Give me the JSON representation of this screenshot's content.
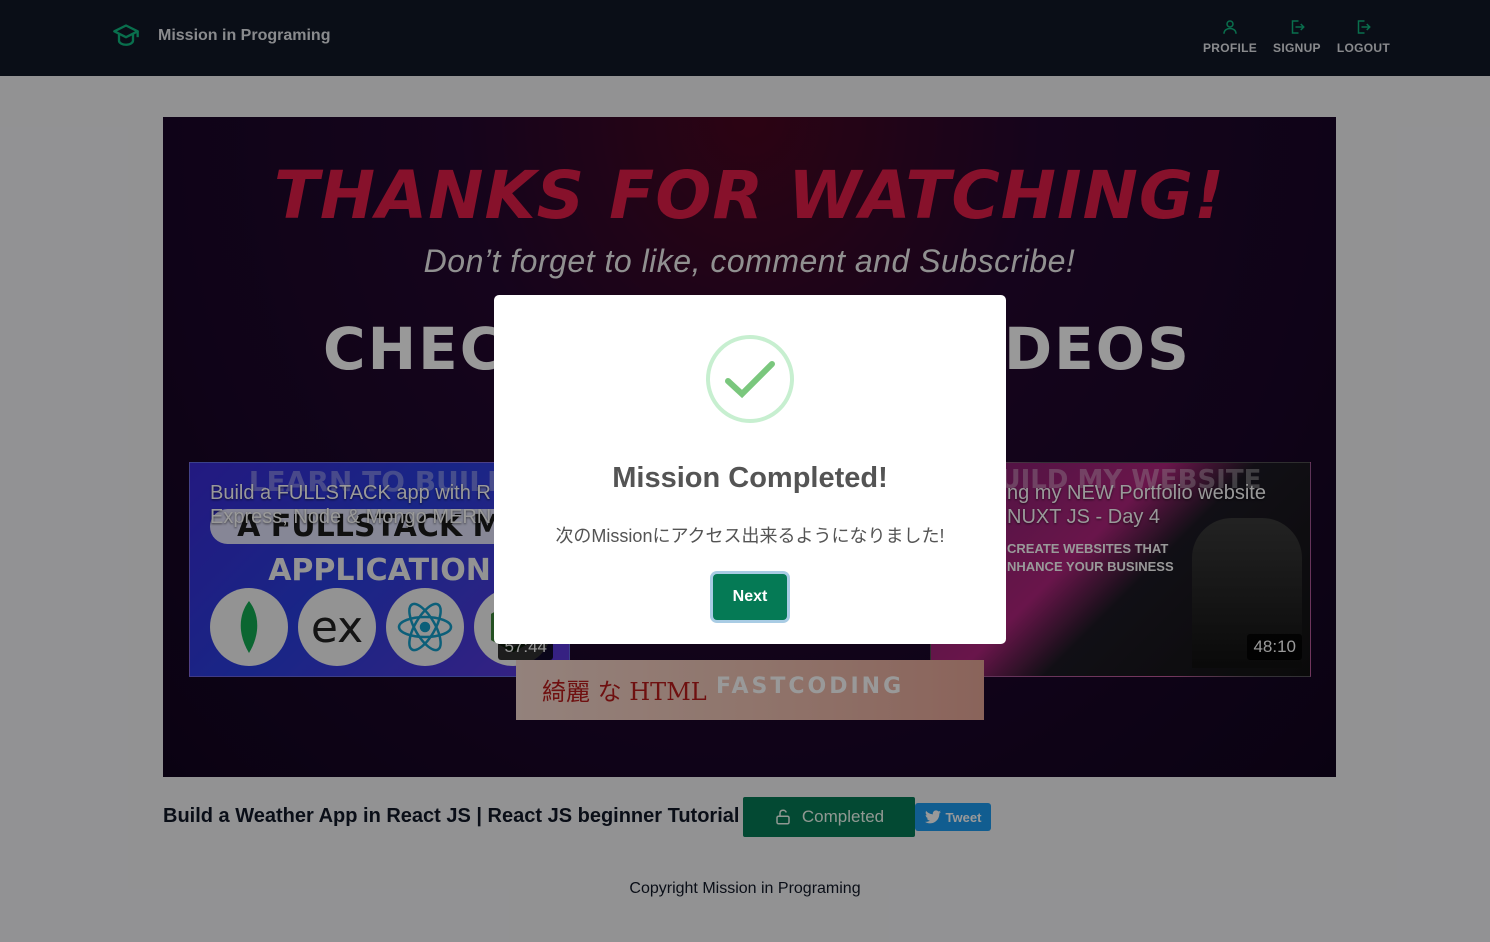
{
  "header": {
    "brand_title": "Mission in Programing",
    "brand_icon": "graduation-cap-icon",
    "nav": [
      {
        "label": "PROFILE",
        "icon": "user-icon"
      },
      {
        "label": "SIGNUP",
        "icon": "login-icon"
      },
      {
        "label": "LOGOUT",
        "icon": "logout-icon"
      }
    ],
    "accent_color": "#10b981"
  },
  "video": {
    "end_screen": {
      "headline": "THANKS FOR WATCHING!",
      "subline": "Don’t forget to like, comment and Subscribe!",
      "check_text_left": "CHEC",
      "check_text_right": "DEOS"
    },
    "cards": [
      {
        "title": "Build a FULLSTACK app with R\nExpress, Node & Mongo MERN",
        "overlay_text_1": "LEARN TO BUILD",
        "overlay_text_2": "A FULLSTACK ME",
        "overlay_text_3": "APPLICATION",
        "logo_text": "ex",
        "duration": "57:44"
      },
      {
        "title": "ng my NEW Portfolio website\nNUXT JS - Day 4",
        "overlay_text_1": "BUILD MY WEBSITE",
        "body_line_1": "CREATE WEBSITES THAT",
        "body_line_2": "NHANCE YOUR BUSINESS",
        "duration": "48:10"
      },
      {
        "jp_text": "綺麗 な HTML",
        "brand_text": "FASTCODING"
      }
    ]
  },
  "video_info": {
    "title": "Build a Weather App in React JS | React JS beginner Tutorial",
    "completed_label": "Completed",
    "tweet_label": "Tweet"
  },
  "footer": {
    "copyright": "Copyright Mission in Programing"
  },
  "modal": {
    "title": "Mission Completed!",
    "message": "次のMissionにアクセス出来るようになりました!",
    "next_label": "Next",
    "success_color": "#7ac77d"
  }
}
